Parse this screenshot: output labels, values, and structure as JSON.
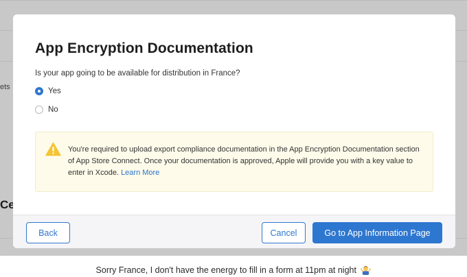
{
  "background": {
    "fragment_left": "ets",
    "fragment_heading": "Ce"
  },
  "modal": {
    "title": "App Encryption Documentation",
    "question": "Is your app going to be available for distribution in France?",
    "options": [
      {
        "label": "Yes",
        "selected": true
      },
      {
        "label": "No",
        "selected": false
      }
    ],
    "notice": {
      "icon": "warning-icon",
      "text": "You're required to upload export compliance documentation in the App Encryption Documentation section of App Store Connect. Once your documentation is approved, Apple will provide you with a key value to enter in Xcode.",
      "link": "Learn More"
    },
    "footer": {
      "back_label": "Back",
      "cancel_label": "Cancel",
      "primary_label": "Go to App Information Page"
    }
  },
  "caption": {
    "text": "Sorry France, I don't have the energy to fill in a form at 11pm at night",
    "emoji": "person-shrugging-emoji"
  },
  "colors": {
    "accent": "#2e77d0",
    "notice_bg": "#fefbea",
    "warning": "#f5c433",
    "backdrop": "#c8c8c8"
  }
}
